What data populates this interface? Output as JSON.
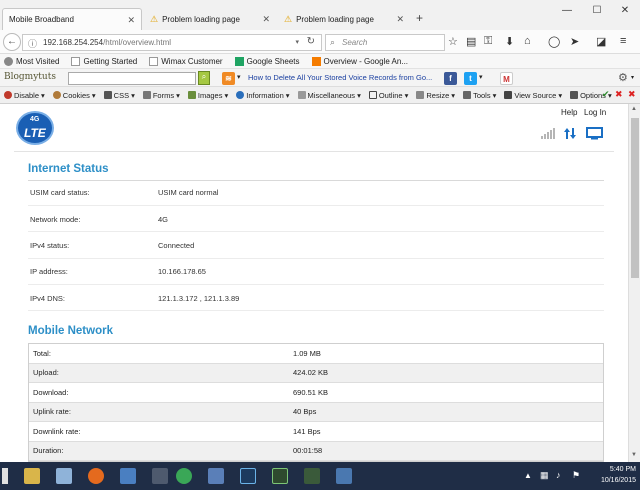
{
  "browser": {
    "tabs": [
      {
        "title": "Mobile Broadband",
        "active": true
      },
      {
        "title": "Problem loading page",
        "active": false
      },
      {
        "title": "Problem loading page",
        "active": false
      }
    ],
    "new_tab": "+",
    "window": {
      "minimize": "—",
      "maximize": "☐",
      "close": "✕"
    },
    "url_prefix": "192.168.254.254",
    "url_path": "/html/overview.html",
    "search_placeholder": "Search",
    "bookmarks": [
      "Most Visited",
      "Getting Started",
      "Wimax Customer",
      "Google Sheets",
      "Overview - Google An..."
    ],
    "toolbar2": {
      "logo": "Blogmytuts",
      "link": "How to Delete All Your Stored Voice Records from Go..."
    },
    "devbar": [
      "Disable",
      "Cookies",
      "CSS",
      "Forms",
      "Images",
      "Information",
      "Miscellaneous",
      "Outline",
      "Resize",
      "Tools",
      "View Source",
      "Options"
    ]
  },
  "page": {
    "logo_small": "4G",
    "logo_big": "LTE",
    "help": "Help",
    "login": "Log In",
    "internet_status": {
      "title": "Internet Status",
      "rows": [
        {
          "label": "USIM card status:",
          "value": "USIM card normal"
        },
        {
          "label": "Network mode:",
          "value": "4G"
        },
        {
          "label": "IPv4 status:",
          "value": "Connected"
        },
        {
          "label": "IP address:",
          "value": "10.166.178.65"
        },
        {
          "label": "IPv4 DNS:",
          "value": "121.1.3.172 , 121.1.3.89"
        }
      ]
    },
    "mobile_network": {
      "title": "Mobile Network",
      "rows": [
        {
          "label": "Total:",
          "value": "1.09 MB"
        },
        {
          "label": "Upload:",
          "value": "424.02 KB"
        },
        {
          "label": "Download:",
          "value": "690.51 KB"
        },
        {
          "label": "Uplink rate:",
          "value": "40 Bps"
        },
        {
          "label": "Downlink rate:",
          "value": "141 Bps"
        },
        {
          "label": "Duration:",
          "value": "00:01:58"
        }
      ]
    }
  },
  "taskbar": {
    "time": "5:40 PM",
    "date": "10/16/2015"
  },
  "colors": {
    "accent": "#2d8fc7",
    "taskbar": "#1f2d46"
  }
}
